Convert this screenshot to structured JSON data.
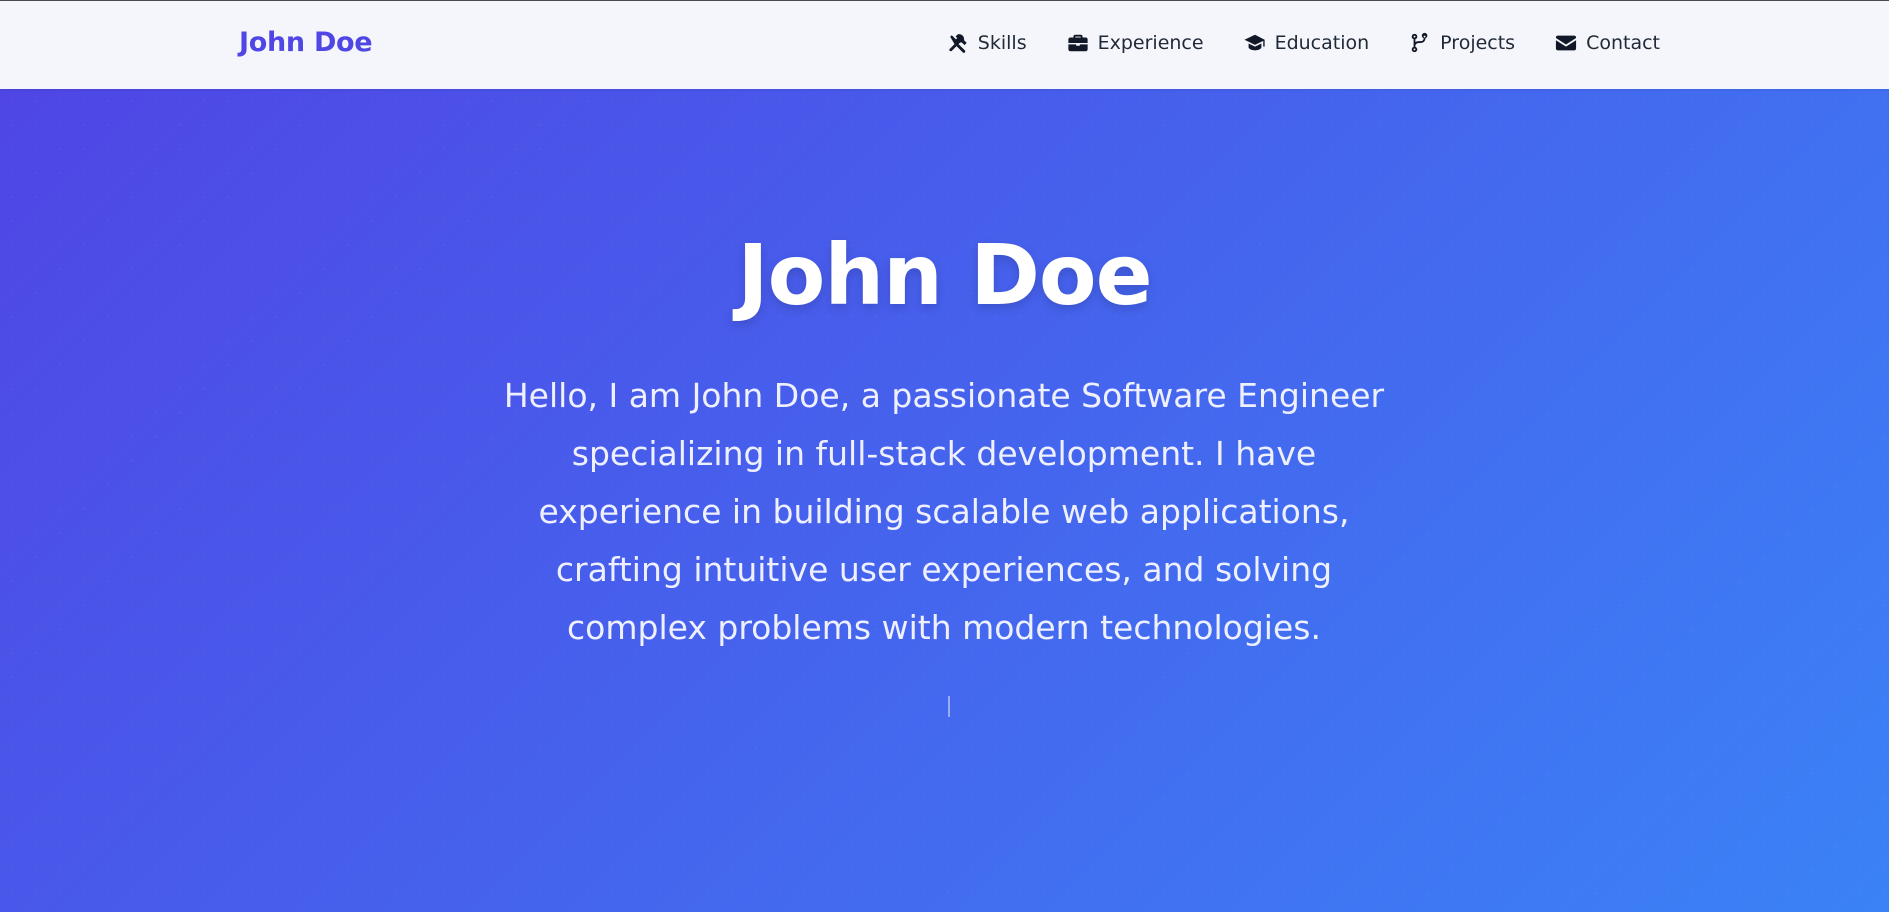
{
  "brand": "John Doe",
  "nav": [
    {
      "label": "Skills",
      "icon": "tools-icon"
    },
    {
      "label": "Experience",
      "icon": "briefcase-icon"
    },
    {
      "label": "Education",
      "icon": "graduation-cap-icon"
    },
    {
      "label": "Projects",
      "icon": "code-branch-icon"
    },
    {
      "label": "Contact",
      "icon": "envelope-icon"
    }
  ],
  "hero": {
    "title": "John Doe",
    "text": "Hello, I am John Doe, a passionate Software Engineer specializing in full-stack development. I have experience in building scalable web applications, crafting intuitive user experiences, and solving complex problems with modern technologies."
  },
  "colors": {
    "accent": "#4f46e5",
    "gradient_start": "#4f46e5",
    "gradient_end": "#3b82f6",
    "nav_bg": "#f5f6fb"
  }
}
